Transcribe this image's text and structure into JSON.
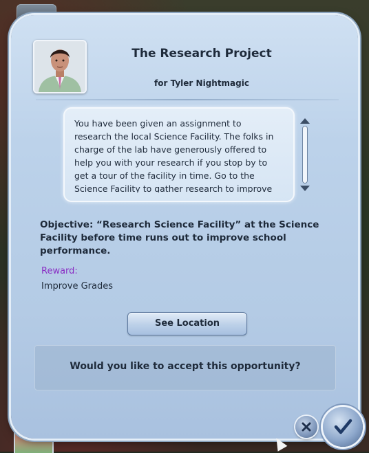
{
  "dialog": {
    "title": "The Research Project",
    "subtitle": "for Tyler Nightmagic",
    "description": "You have been given an assignment to research the local Science Facility. The folks in charge of the lab have generously offered to help you with your research if you stop by to get a tour of the facility in time. Go to the Science Facility to gather research to improve",
    "objective": "Objective: “Research Science Facility” at the Science Facility before time runs out to improve school performance.",
    "reward_label": "Reward:",
    "reward_value": "Improve Grades",
    "see_location_label": "See Location",
    "question": "Would you like to accept this opportunity?"
  },
  "icons": {
    "portrait": "sim-portrait",
    "scroll_up": "triangle-up-icon",
    "scroll_down": "triangle-down-icon",
    "decline": "close-icon",
    "accept": "checkmark-icon"
  },
  "colors": {
    "panel": "#bcd2ea",
    "text": "#1e2a3a",
    "reward_label": "#8a2fc4",
    "accept_check": "#1f3a66"
  }
}
